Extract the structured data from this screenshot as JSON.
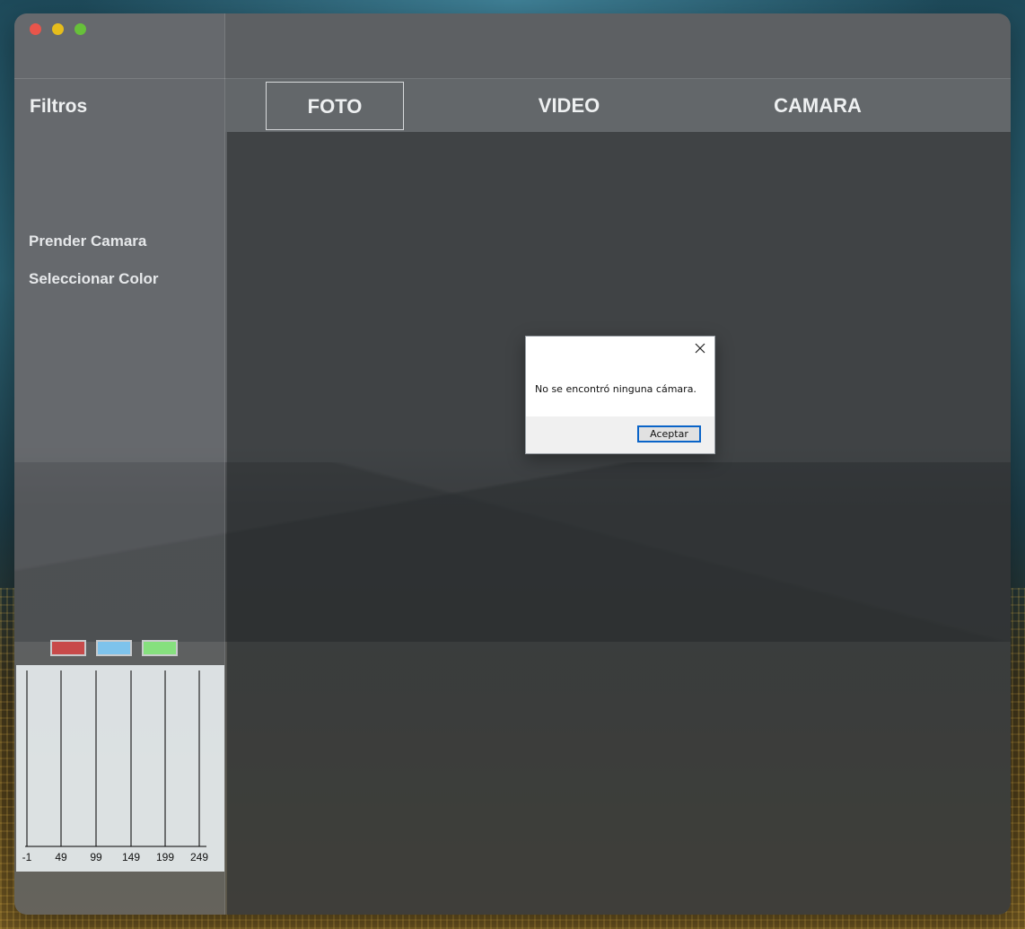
{
  "sidebar": {
    "title": "Filtros",
    "links": [
      "Prender Camara",
      "Seleccionar Color"
    ],
    "swatches": [
      {
        "name": "red",
        "color": "#c84a4a"
      },
      {
        "name": "blue",
        "color": "#7ec3ec"
      },
      {
        "name": "green",
        "color": "#86e07e"
      }
    ]
  },
  "tabs": [
    "FOTO",
    "VIDEO",
    "CAMARA"
  ],
  "active_tab": "FOTO",
  "histogram": {
    "ticks": [
      "-1",
      "49",
      "99",
      "149",
      "199",
      "249"
    ]
  },
  "dialog": {
    "message": "No se encontró ninguna cámara.",
    "button": "Aceptar"
  }
}
